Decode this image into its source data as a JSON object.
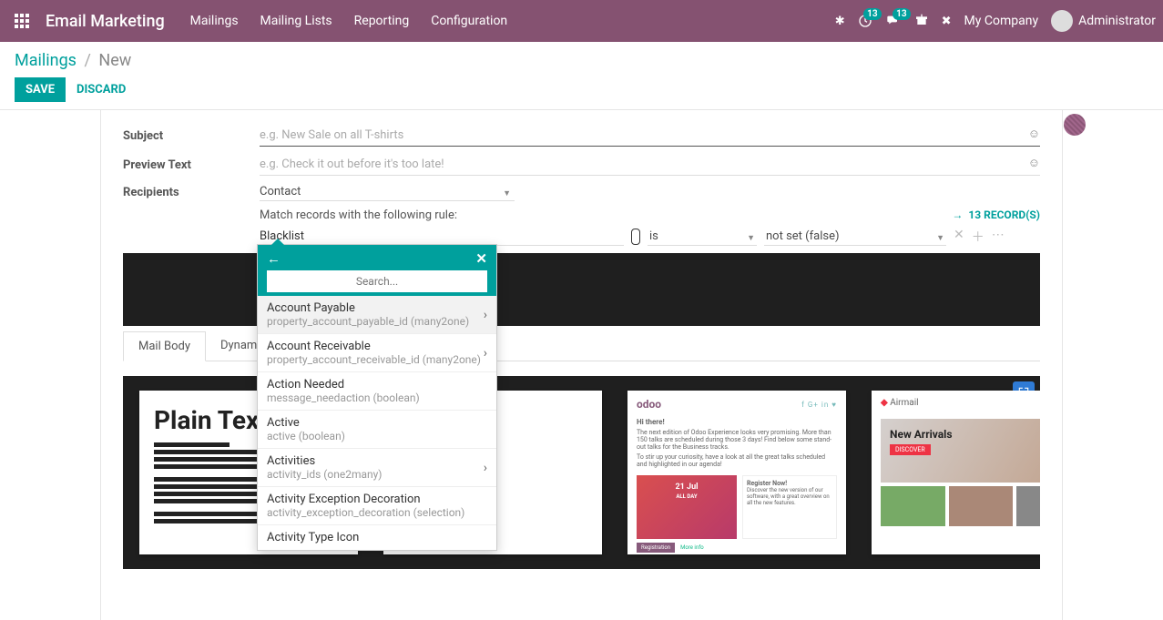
{
  "brand": "Email Marketing",
  "nav": [
    "Mailings",
    "Mailing Lists",
    "Reporting",
    "Configuration"
  ],
  "badges": {
    "activity": "13",
    "discuss": "13"
  },
  "company": "My Company",
  "user": "Administrator",
  "breadcrumb": {
    "root": "Mailings",
    "current": "New"
  },
  "buttons": {
    "save": "SAVE",
    "discard": "DISCARD"
  },
  "form": {
    "subject_label": "Subject",
    "subject_placeholder": "e.g. New Sale on all T-shirts",
    "preview_label": "Preview Text",
    "preview_placeholder": "e.g. Check it out before it's too late!",
    "recipients_label": "Recipients",
    "recipients_value": "Contact",
    "match_text": "Match records with the following rule:",
    "records_link": "13 RECORD(S)",
    "rule_field": "Blacklist",
    "rule_op": "is",
    "rule_val": "not set (false)"
  },
  "tabs": {
    "body": "Mail Body",
    "dynamic": "Dynamic I"
  },
  "templates": {
    "plain": "Plain Tex",
    "odoo_greet": "Hi there!",
    "odoo_p1": "The next edition of Odoo Experience looks very promising. More than 150 talks are scheduled during those 3 days! Find below some stand-out talks for the Business tracks.",
    "odoo_p2": "To stir up your curiosity, have a look at all the great talks scheduled and highlighted in our agenda!",
    "odoo_date": "21 Jul",
    "odoo_allday": "ALL DAY",
    "odoo_reg_title": "Register Now!",
    "odoo_reg_text": "Discover the new version of our software, with a great overview on all the new features.",
    "odoo_reg_btn": "Registration",
    "odoo_more": "More info",
    "airmail": "Airmail",
    "airmail_h": "New Arrivals",
    "airmail_btn": "DISCOVER"
  },
  "popover": {
    "search_placeholder": "Search...",
    "items": [
      {
        "label": "Account Payable",
        "tech": "property_account_payable_id (many2one)",
        "arrow": true
      },
      {
        "label": "Account Receivable",
        "tech": "property_account_receivable_id (many2one)",
        "arrow": true
      },
      {
        "label": "Action Needed",
        "tech": "message_needaction (boolean)",
        "arrow": false
      },
      {
        "label": "Active",
        "tech": "active (boolean)",
        "arrow": false
      },
      {
        "label": "Activities",
        "tech": "activity_ids (one2many)",
        "arrow": true
      },
      {
        "label": "Activity Exception Decoration",
        "tech": "activity_exception_decoration (selection)",
        "arrow": false
      },
      {
        "label": "Activity Type Icon",
        "tech": "",
        "arrow": false
      }
    ]
  }
}
